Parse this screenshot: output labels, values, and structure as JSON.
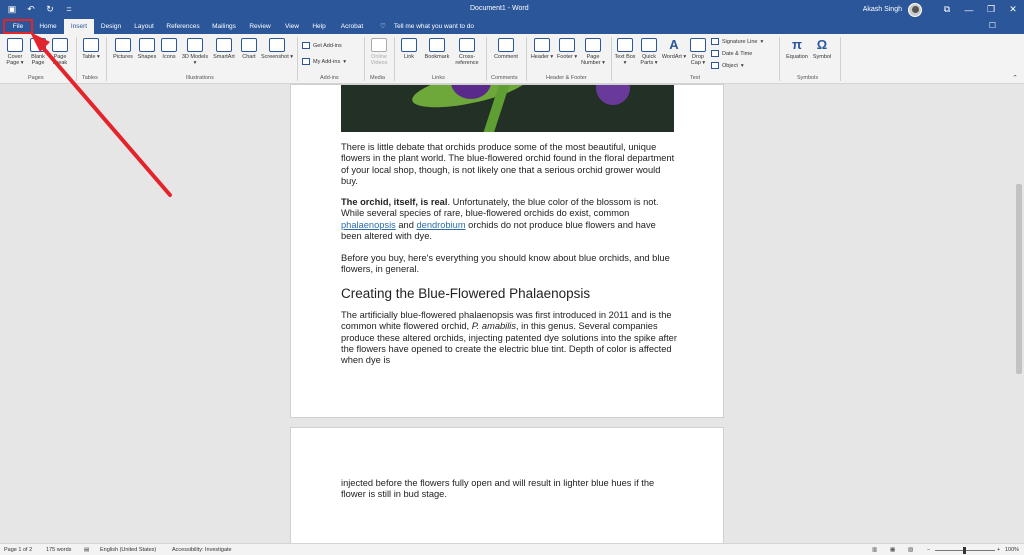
{
  "titlebar": {
    "document_title": "Document1 - Word",
    "user_name": "Akash Singh",
    "qa_undo": "↶",
    "qa_redo": "↻",
    "qa_more": "="
  },
  "tabs": [
    {
      "label": "File"
    },
    {
      "label": "Home"
    },
    {
      "label": "Insert"
    },
    {
      "label": "Design"
    },
    {
      "label": "Layout"
    },
    {
      "label": "References"
    },
    {
      "label": "Mailings"
    },
    {
      "label": "Review"
    },
    {
      "label": "View"
    },
    {
      "label": "Help"
    },
    {
      "label": "Acrobat"
    }
  ],
  "tell_me": "Tell me what you want to do",
  "ribbon": {
    "cover_page": "Cover Page ▾",
    "blank_page": "Blank Page",
    "page_break": "Page Break",
    "pages_group": "Pages",
    "table": "Table ▾",
    "tables_group": "Tables",
    "pictures": "Pictures",
    "shapes": "Shapes",
    "icons": "Icons",
    "models_3d": "3D Models ▾",
    "smartart": "SmartArt",
    "chart": "Chart",
    "screenshot": "Screenshot ▾",
    "illustrations_group": "Illustrations",
    "get_addins": "Get Add-ins",
    "my_addins": "My Add-ins",
    "addins_group": "Add-ins",
    "online_videos": "Online Videos",
    "media_group": "Media",
    "link": "Link",
    "bookmark": "Bookmark",
    "cross_reference": "Cross-reference",
    "links_group": "Links",
    "comment": "Comment",
    "comments_group": "Comments",
    "header": "Header ▾",
    "footer": "Footer ▾",
    "page_number": "Page Number ▾",
    "header_footer_group": "Header & Footer",
    "text_box": "Text Box ▾",
    "quick_parts": "Quick Parts ▾",
    "wordart": "WordArt ▾",
    "drop_cap": "Drop Cap ▾",
    "signature_line": "Signature Line",
    "date_time": "Date & Time",
    "object": "Object",
    "text_group": "Text",
    "equation": "Equation",
    "symbol": "Symbol",
    "symbols_group": "Symbols"
  },
  "document": {
    "p1": "There is little debate that orchids produce some of the most beautiful, unique flowers in the plant world. The blue-flowered orchid found in the floral department of your local shop, though, is not likely one that a serious orchid grower would buy.",
    "p2_bold": "The orchid, itself, is real",
    "p2_a": ". Unfortunately, the blue color of the blossom is not. While several species of rare, blue-flowered orchids do exist, common ",
    "p2_link1": "phalaenopsis",
    "p2_b": " and ",
    "p2_link2": "dendrobium",
    "p2_c": " orchids do not produce blue flowers and have been altered with dye.",
    "p3": "Before you buy, here's everything you should know about blue orchids, and blue flowers, in general.",
    "heading": "Creating the Blue-Flowered Phalaenopsis",
    "p4_a": "The artificially blue-flowered phalaenopsis was first introduced in 2011 and is the common white flowered orchid, ",
    "p4_italic": "P. amabilis",
    "p4_b": ", in this genus. Several companies produce these altered orchids, injecting patented dye solutions into the spike after the flowers have opened to create the electric blue tint. Depth of color is affected when dye is",
    "p5": "injected before the flowers fully open and will result in lighter blue hues if the flower is still in bud stage."
  },
  "status": {
    "page": "Page 1 of 2",
    "words": "175 words",
    "language": "English (United States)",
    "accessibility": "Accessibility: Investigate",
    "zoom": "100%"
  },
  "colors": {
    "accent": "#2b579a",
    "annotation": "#e3242b"
  }
}
